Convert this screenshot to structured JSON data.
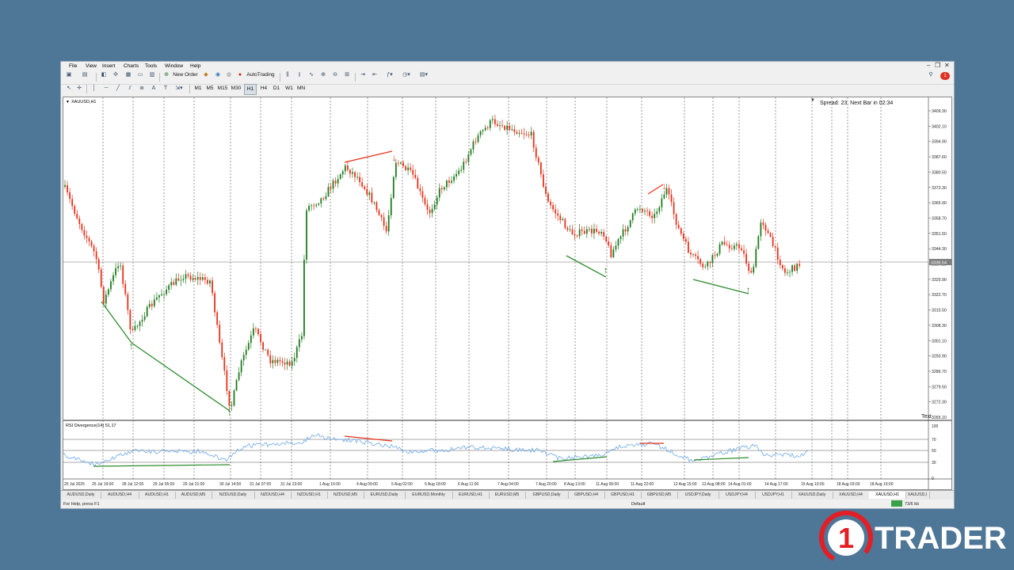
{
  "menu": [
    "File",
    "View",
    "Insert",
    "Charts",
    "Tools",
    "Window",
    "Help"
  ],
  "toolbar": {
    "new_order_label": "New Order",
    "autotrading_label": "AutoTrading",
    "timeframes": [
      "M1",
      "M5",
      "M15",
      "M30",
      "H1",
      "H4",
      "D1",
      "W1",
      "MN"
    ],
    "active_timeframe": "H1"
  },
  "chart": {
    "symbol_label": "XAUUSD,H1",
    "spread_text": "Spread: 23. Next Bar in 02:34",
    "corner_label": "Text",
    "current_price": "3338.54",
    "price_ticks": [
      "3409.30",
      "3402.10",
      "3394.90",
      "3387.60",
      "3380.50",
      "3373.30",
      "3365.90",
      "3358.70",
      "3351.50",
      "3344.30",
      "3337.10",
      "3329.90",
      "3322.70",
      "3315.50",
      "3308.30",
      "3301.10",
      "3293.90",
      "3286.70",
      "3279.50",
      "3272.30",
      "3265.10"
    ],
    "time_labels": [
      "25 Jul 2025",
      "25 Jul 19:00",
      "28 Jul 12:00",
      "29 Jul 05:00",
      "29 Jul 21:00",
      "30 Jul 14:00",
      "31 Jul 07:00",
      "31 Jul 23:00",
      "1 Aug 16:00",
      "4 Aug 09:00",
      "5 Aug 02:00",
      "5 Aug 18:00",
      "6 Aug 11:00",
      "7 Aug 04:00",
      "7 Aug 20:00",
      "8 Aug 13:00",
      "11 Aug 06:00",
      "11 Aug 22:00",
      "12 Aug 15:00",
      "13 Aug 08:00",
      "14 Aug 01:00",
      "14 Aug 17:00",
      "15 Aug 10:00",
      "18 Aug 03:00",
      "18 Aug 19:00"
    ],
    "colors": {
      "up": "#1f7a1f",
      "down": "#e8311a",
      "rsi": "#6aa8e8",
      "bull_div": "#2e8b2e",
      "bear_div": "#e8311a"
    }
  },
  "indicator": {
    "label": "RSI Divergence(14) 51.17",
    "levels": [
      "100",
      "70",
      "50",
      "30",
      "0"
    ]
  },
  "tabs": [
    "AUDUSD,Daily",
    "AUDUSD,H4",
    "AUDUSD,H1",
    "AUDUSD,M5",
    "NZDUSD,Daily",
    "NZDUSD,H4",
    "NZDUSD,H1",
    "NZDUSD,M5",
    "EURUSD,Daily",
    "EURUSD,Monthly",
    "EURUSD,H1",
    "EURUSD,M5",
    "GBPUSD,Daily",
    "GBPUSD,H4",
    "GBPUSD,H1",
    "GBPUSD,M5",
    "USDJPY,Daily",
    "USDJPY,H4",
    "USDJPY,H1",
    "XAUUSD,Daily",
    "XAUUSD,H4",
    "XAUUSD,H1",
    "XAUUSD,I"
  ],
  "active_tab": "XAUUSD,H1",
  "status": {
    "help": "For Help, press F1",
    "profile": "Default",
    "traffic": "73/6 kb"
  },
  "brand": {
    "number": "1",
    "name": "TRADER",
    "accent": "#e31e24"
  }
}
